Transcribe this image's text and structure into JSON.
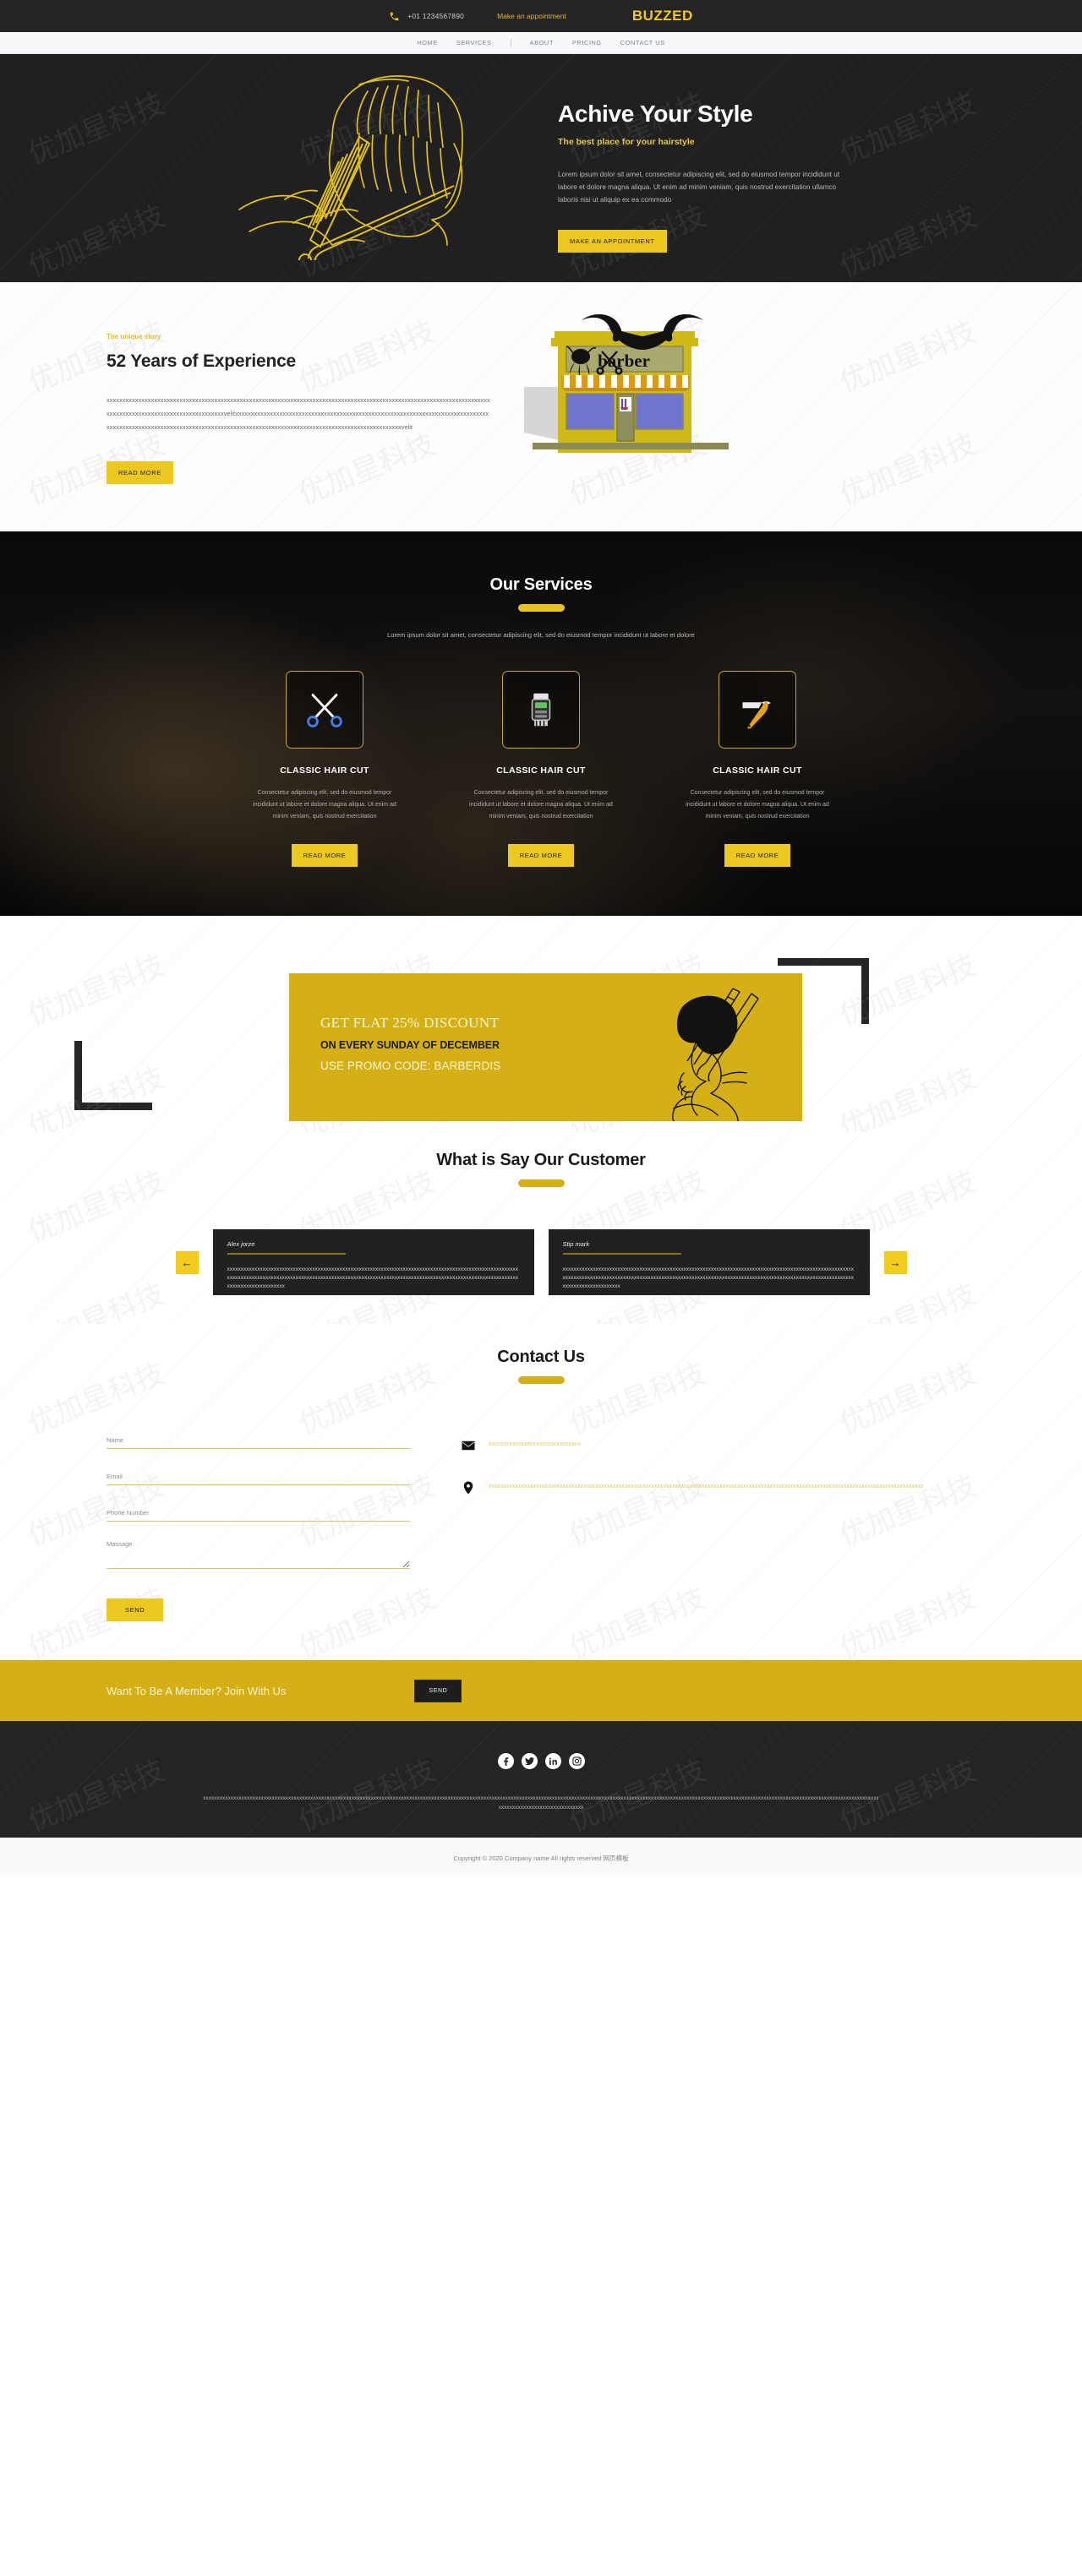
{
  "topbar": {
    "phone_icon": "phone-icon",
    "phone": "+01 1234567890",
    "appointment_link": "Make an appointment",
    "brand": "BUZZED"
  },
  "nav": {
    "items": [
      {
        "label": "HOME"
      },
      {
        "label": "SERVICES"
      },
      {
        "label": "ABOUT"
      },
      {
        "label": "PRICING"
      },
      {
        "label": "CONTACT US"
      }
    ]
  },
  "hero": {
    "title": "Achive Your Style",
    "subtitle": "The best place for your hairstyle",
    "paragraph": "Lorem ipsum dolor sit amet, consectetur adipiscing elit, sed do eiusmod tempor incididunt ut labore et dolore magna aliqua. Ut enim ad minim veniam, quis nostrud exercitation ullamco laboris nisi ut aliquip ex ea commodo",
    "cta": "MAKE AN APPOINTMENT",
    "slider_dots": 4,
    "active_dot": 0,
    "illustration": "barber-cutting-hair-lineart",
    "accent": "#edc821",
    "background": "#202020"
  },
  "about": {
    "tag": "The unique story",
    "title": "52 Years of Experience",
    "paragraph": "xxxxxxxxxxxxxxxxxxxxxxxxxxxxxxxxxxxxxxxxxxxxxxxxxxxxxxxxxxxxxxxxxxxxxxxxxxxxxxxxxxxxxxxxxxxxxxxxxxxxxxxxxxxxxxxxxxxxxxxxxxxxxxxxxxxxxxxxxxxxxxxxxxxxxxxxxxxxxxvelitxxxxxxxxxxxxxxxxxxxxxxxxxxxxxxxxxxxxxxxxxxxxxxxxxxxxxxxxxxxxxxxxxxxxxxxxxxxxxxxxxxxxxxxxxxxxxxxxxxxxxxxxxxxxxxxxxxxxxxxxxxxxxxxxxxxxxxxxxxxxxxxxxxxxxxxxxxxxxxxxxxxxxxxxxxxxxvelit",
    "cta": "READ MORE",
    "illustration": "barber-shop-storefront",
    "shop_sign": "barber"
  },
  "services": {
    "title": "Our Services",
    "lead": "Lorem ipsum dolor sit amet, consectetur adipiscing elit, sed do eiusmod tempor incididunt ut labore et dolore",
    "cards": [
      {
        "icon": "scissors-icon",
        "title": "CLASSIC HAIR CUT",
        "text": "Consectetur adipiscing elit, sed do eiusmod tempor incididunt ut labore et dolore magna aliqua. Ut enim ad minim veniam, quis nostrud exercitation",
        "cta": "READ MORE"
      },
      {
        "icon": "hair-clipper-icon",
        "title": "CLASSIC HAIR CUT",
        "text": "Consectetur adipiscing elit, sed do eiusmod tempor incididunt ut labore et dolore magna aliqua. Ut enim ad minim veniam, quis nostrud exercitation",
        "cta": "READ MORE"
      },
      {
        "icon": "straight-razor-icon",
        "title": "CLASSIC HAIR CUT",
        "text": "Consectetur adipiscing elit, sed do eiusmod tempor incididunt ut labore et dolore magna aliqua. Ut enim ad minim veniam, quis nostrud exercitation",
        "cta": "READ MORE"
      }
    ]
  },
  "discount": {
    "line1": "GET FLAT 25% DISCOUNT",
    "line2": "ON EVERY SUNDAY OF DECEMBER",
    "line3": "USE PROMO CODE: BARBERDIS",
    "illustration": "man-getting-haircut-lineart",
    "background": "#d4af15"
  },
  "testimonials": {
    "title": "What is Say Our Customer",
    "prev_icon": "arrow-left-icon",
    "next_icon": "arrow-right-icon",
    "items": [
      {
        "name": "Alex jorze",
        "text": "xxxxxxxxxxxxxxxxxxxxxxxxxxxxxxxxxxxxxxxxxxxxxxxxxxxxxxxxxxxxxxxxxxxxxxxxxxxxxxxxxxxxxxxxxxxxxxxxxxxxxxxxxxxxxxxxxxxxxxxxxxxxxxxxxxxxxxxxxxxxxxxxxxxxxxxxxxxxxxxxxxxxxxxxxxxxxxxxxxxxxxxxxxxxxxxxxxxxxxxxxxxxxxxxxxxxxxxxxxxxxxxxxxxxxxxxx"
      },
      {
        "name": "Stip mark",
        "text": "xxxxxxxxxxxxxxxxxxxxxxxxxxxxxxxxxxxxxxxxxxxxxxxxxxxxxxxxxxxxxxxxxxxxxxxxxxxxxxxxxxxxxxxxxxxxxxxxxxxxxxxxxxxxxxxxxxxxxxxxxxxxxxxxxxxxxxxxxxxxxxxxxxxxxxxxxxxxxxxxxxxxxxxxxxxxxxxxxxxxxxxxxxxxxxxxxxxxxxxxxxxxxxxxxxxxxxxxxxxxxxxxxxxxxxxxx"
      }
    ]
  },
  "contact": {
    "title": "Contact Us",
    "fields": [
      {
        "name": "name-field",
        "placeholder": "Name",
        "value": ""
      },
      {
        "name": "email-field",
        "placeholder": "Email",
        "value": ""
      },
      {
        "name": "phone-field",
        "placeholder": "Phone Number",
        "value": ""
      },
      {
        "name": "message-field",
        "placeholder": "Massage",
        "value": ""
      }
    ],
    "send_label": "SEND",
    "info": [
      {
        "icon": "envelope-icon",
        "text": "xxxxxxxxxxxxxxxxxxxxxxxxxxxxxxx"
      },
      {
        "icon": "map-pin-icon",
        "text": "xxxxxxxxxxxxxxxxxxxxxxxxxxxxxxxxxxxxxxxxxxxxxxxxxxxxxxxxxxxxxxxxxxxxxxxxxxxxxxxxxxxxxxxxxxxxxxxxxxxxxxxxxxxxxxxxxxxxxxxxxxxxxxxxxxxxxxxxxxxxxxxxxxx"
      }
    ]
  },
  "member": {
    "text": "Want To Be A Member? Join With Us",
    "button": "SEND"
  },
  "footer": {
    "socials": [
      {
        "icon": "facebook-icon",
        "glyph": "f"
      },
      {
        "icon": "twitter-icon",
        "glyph": "t"
      },
      {
        "icon": "linkedin-icon",
        "glyph": "in"
      },
      {
        "icon": "instagram-icon",
        "glyph": "ig"
      }
    ],
    "paragraph": "xxxxxxxxxxxxxxxxxxxxxxxxxxxxxxxxxxxxxxxxxxxxxxxxxxxxxxxxxxxxxxxxxxxxxxxxxxxxxxxxxxxxxxxxxxxxxxxxxxxxxxxxxxxxxxxxxxxxxxxxxxxxxxxxxxxxxxxxxxxxxxxxxxxxxxxxxxxxxxxxxxxxxxxxxxxxxxxxxxxxxxxxxxxxxxxxxxxxxxxxxxxxxxxxxxxxxxxxxxxxxxxxxxxxxxxxxxxxxxxxxxxxxxxxxxxxxxxxxxxxxxxxxxxxxxxxxxxxx",
    "copyright": "Copyright © 2020.Company name All rights reserved 网页模板"
  },
  "watermark": "优加星科技"
}
